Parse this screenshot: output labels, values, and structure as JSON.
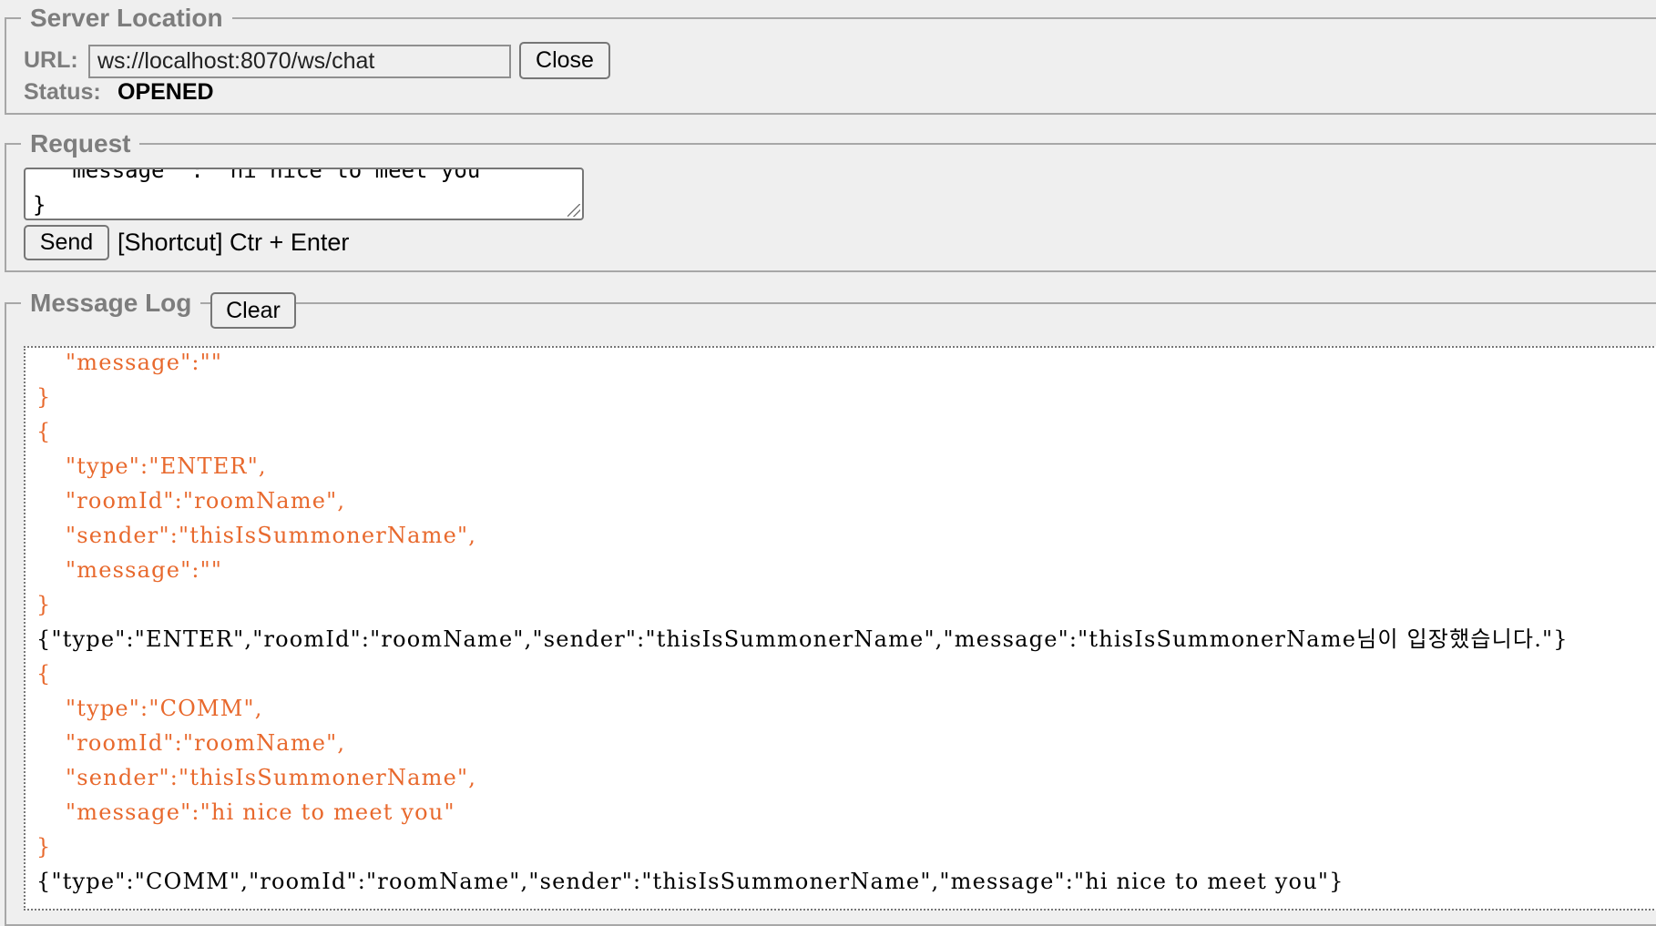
{
  "server_location": {
    "legend": "Server Location",
    "url_label": "URL:",
    "url_value": "ws://localhost:8070/ws/chat",
    "close_button": "Close",
    "status_label": "Status:",
    "status_value": "OPENED"
  },
  "request": {
    "legend": "Request",
    "textarea_visible_lines": [
      "  \"message\" : \"hi nice to meet you\"",
      "}"
    ],
    "send_button": "Send",
    "shortcut_text": "[Shortcut] Ctr + Enter"
  },
  "message_log": {
    "legend": "Message Log",
    "clear_button": "Clear",
    "lines": [
      {
        "text": "\"message\":\"\"",
        "kind": "sent",
        "indent": true
      },
      {
        "text": "}",
        "kind": "sent",
        "indent": false
      },
      {
        "text": "{",
        "kind": "sent",
        "indent": false
      },
      {
        "text": "\"type\":\"ENTER\",",
        "kind": "sent",
        "indent": true
      },
      {
        "text": "\"roomId\":\"roomName\",",
        "kind": "sent",
        "indent": true
      },
      {
        "text": "\"sender\":\"thisIsSummonerName\",",
        "kind": "sent",
        "indent": true
      },
      {
        "text": "\"message\":\"\"",
        "kind": "sent",
        "indent": true
      },
      {
        "text": "}",
        "kind": "sent",
        "indent": false
      },
      {
        "text": "{\"type\":\"ENTER\",\"roomId\":\"roomName\",\"sender\":\"thisIsSummonerName\",\"message\":\"thisIsSummonerName님이 입장했습니다.\"}",
        "kind": "recv",
        "indent": false
      },
      {
        "text": "{",
        "kind": "sent",
        "indent": false
      },
      {
        "text": "\"type\":\"COMM\",",
        "kind": "sent",
        "indent": true
      },
      {
        "text": "\"roomId\":\"roomName\",",
        "kind": "sent",
        "indent": true
      },
      {
        "text": "\"sender\":\"thisIsSummonerName\",",
        "kind": "sent",
        "indent": true
      },
      {
        "text": "\"message\":\"hi nice to meet you\"",
        "kind": "sent",
        "indent": true
      },
      {
        "text": "}",
        "kind": "sent",
        "indent": false
      },
      {
        "text": "{\"type\":\"COMM\",\"roomId\":\"roomName\",\"sender\":\"thisIsSummonerName\",\"message\":\"hi nice to meet you\"}",
        "kind": "recv",
        "indent": false
      }
    ]
  },
  "colors": {
    "sent_text": "#e8692d",
    "received_text": "#000000",
    "legend_text": "#7d7d7d",
    "background": "#efefef"
  }
}
